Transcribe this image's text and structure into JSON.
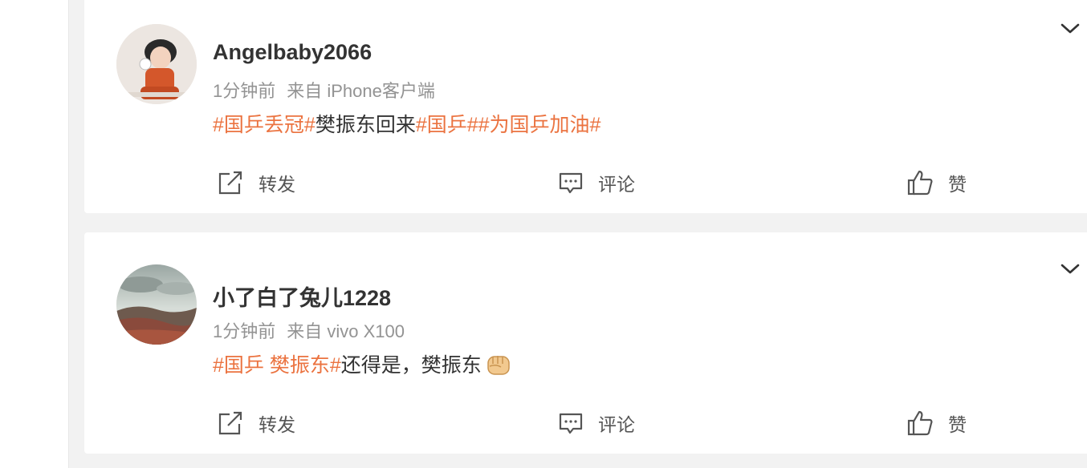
{
  "posts": [
    {
      "author": "Angelbaby2066",
      "time": "1分钟前",
      "source": "来自 iPhone客户端",
      "content": [
        {
          "text": "#国乒丢冠#",
          "tag": true
        },
        {
          "text": "樊振东回来",
          "tag": false
        },
        {
          "text": "#国乒##为国乒加油#",
          "tag": true
        }
      ],
      "emoji": null
    },
    {
      "author": "小了白了兔儿1228",
      "time": "1分钟前",
      "source": "来自 vivo X100",
      "content": [
        {
          "text": "#国乒 樊振东#",
          "tag": true
        },
        {
          "text": "还得是，樊振东",
          "tag": false
        }
      ],
      "emoji": "fist-emoji"
    }
  ],
  "actions": {
    "repost": "转发",
    "comment": "评论",
    "like": "赞"
  },
  "colors": {
    "tag": "#eb7340",
    "text": "#333333",
    "meta": "#939393"
  },
  "icons": [
    "chevron-down-icon",
    "repost-icon",
    "comment-icon",
    "like-icon"
  ]
}
